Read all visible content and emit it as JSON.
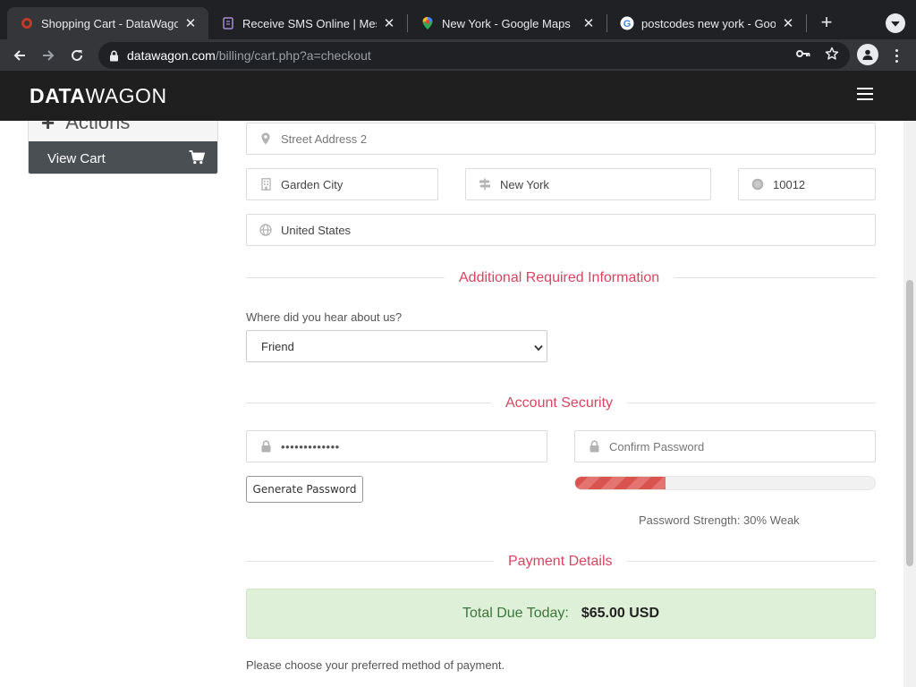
{
  "browser": {
    "tabs": [
      {
        "title": "Shopping Cart - DataWagon",
        "favicon": "datawagon-favicon",
        "active": true
      },
      {
        "title": "Receive SMS Online | Messa",
        "favicon": "sms-favicon",
        "active": false
      },
      {
        "title": "New York - Google Maps",
        "favicon": "google-maps-favicon",
        "active": false
      },
      {
        "title": "postcodes new york - Goog",
        "favicon": "google-favicon",
        "active": false
      }
    ],
    "url_host": "datawagon.com",
    "url_path": "/billing/cart.php?a=checkout"
  },
  "site": {
    "logo_bold": "DATA",
    "logo_regular": "WAGON"
  },
  "sidebar": {
    "heading": "Actions",
    "items": [
      {
        "label": "View Cart",
        "icon": "shopping-cart-icon"
      }
    ]
  },
  "address": {
    "street2_placeholder": "Street Address 2",
    "city": "Garden City",
    "state": "New York",
    "postcode": "10012",
    "country": "United States"
  },
  "additional": {
    "title": "Additional Required Information",
    "hear_label": "Where did you hear about us?",
    "hear_value": "Friend"
  },
  "security": {
    "title": "Account Security",
    "password_value": "•••••••••••••",
    "confirm_placeholder": "Confirm Password",
    "generate_label": "Generate Password",
    "strength_text": "Password Strength: 30% Weak",
    "strength_level": 0.3
  },
  "payment": {
    "title": "Payment Details",
    "total_label": "Total Due Today:",
    "total_value": "$65.00 USD",
    "note": "Please choose your preferred method of payment."
  },
  "colors": {
    "accent": "#d9455f",
    "header_bg": "#1f1f1f",
    "total_bg": "#dff0d8",
    "strength_bar": "#d9534f"
  }
}
